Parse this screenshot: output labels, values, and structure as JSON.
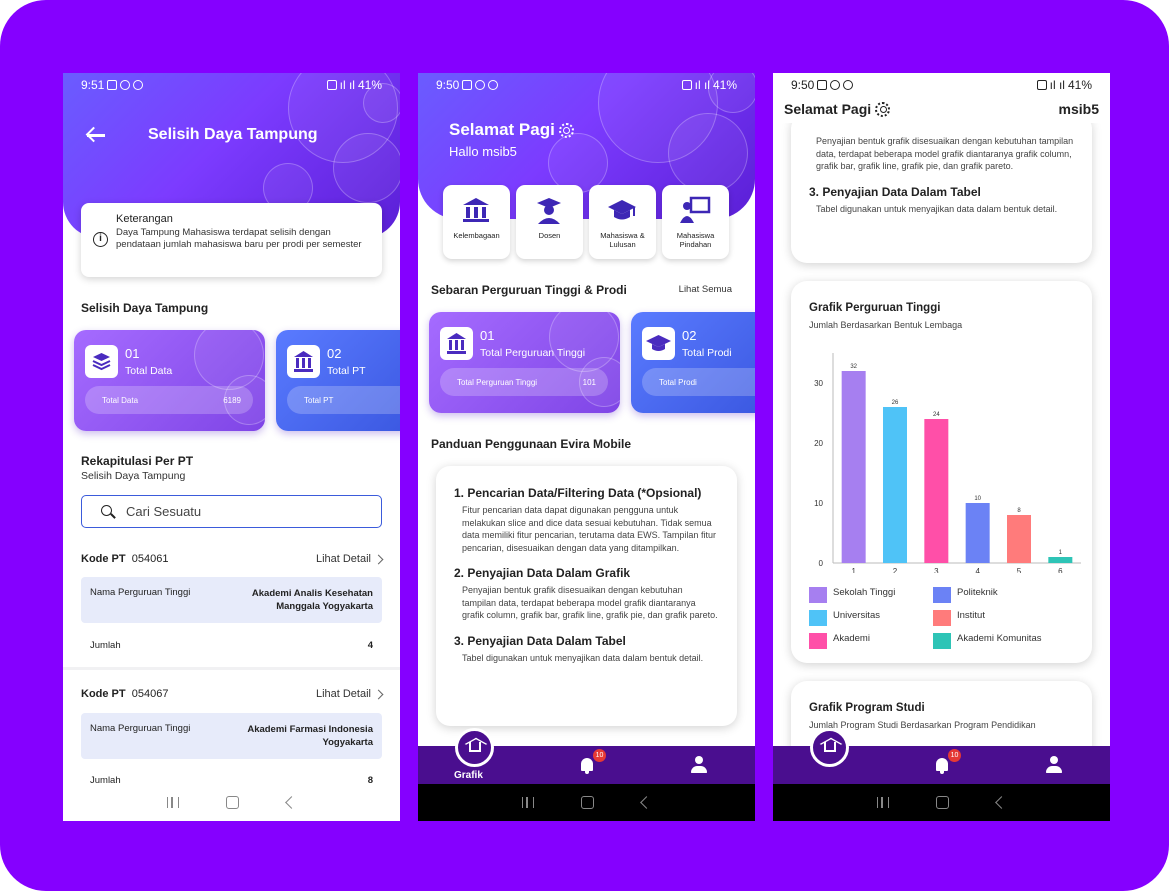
{
  "status_bars": {
    "p1_time": "9:51",
    "p2_time": "9:50",
    "p3_time": "9:50",
    "battery": "41%"
  },
  "screen1": {
    "title": "Selisih Daya Tampung",
    "keterangan_title": "Keterangan",
    "keterangan_body": "Daya Tampung Mahasiswa terdapat selisih dengan pendataan jumlah mahasiswa baru per prodi per semester",
    "section_title": "Selisih Daya Tampung",
    "cards": [
      {
        "num": "01",
        "label": "Total Data",
        "pill_label": "Total Data",
        "pill_value": "6189"
      },
      {
        "num": "02",
        "label": "Total PT",
        "pill_label": "Total PT",
        "pill_value": ""
      }
    ],
    "rekap_title": "Rekapitulasi Per PT",
    "rekap_sub": "Selisih Daya Tampung",
    "search_placeholder": "Cari Sesuatu",
    "rows": [
      {
        "kode_label": "Kode PT",
        "kode": "054061",
        "detail": "Lihat Detail",
        "nama_label": "Nama Perguruan Tinggi",
        "nama": "Akademi Analis Kesehatan Manggala Yogyakarta",
        "jumlah_label": "Jumlah",
        "jumlah": "4"
      },
      {
        "kode_label": "Kode PT",
        "kode": "054067",
        "detail": "Lihat Detail",
        "nama_label": "Nama Perguruan Tinggi",
        "nama": "Akademi Farmasi Indonesia Yogyakarta",
        "jumlah_label": "Jumlah",
        "jumlah": "8"
      }
    ]
  },
  "screen2": {
    "greeting": "Selamat Pagi",
    "hello": "Hallo msib5",
    "menu": [
      "Kelembagaan",
      "Dosen",
      "Mahasiswa & Lulusan",
      "Mahasiswa Pindahan"
    ],
    "sebaran_title": "Sebaran Perguruan Tinggi & Prodi",
    "lihat_semua": "Lihat Semua",
    "cards": [
      {
        "num": "01",
        "label": "Total Perguruan Tinggi",
        "pill_label": "Total Perguruan Tinggi",
        "pill_value": "101"
      },
      {
        "num": "02",
        "label": "Total Prodi",
        "pill_label": "Total Prodi",
        "pill_value": ""
      }
    ],
    "panduan_title": "Panduan Penggunaan Evira Mobile",
    "panduan": [
      {
        "h": "1. Pencarian Data/Filtering Data (*Opsional)",
        "b": "Fitur pencarian data dapat digunakan pengguna untuk melakukan slice and dice data sesuai kebutuhan. Tidak semua data memiliki fitur pencarian, terutama data EWS. Tampilan fitur pencarian, disesuaikan dengan data yang ditampilkan."
      },
      {
        "h": "2. Penyajian Data Dalam Grafik",
        "b": "Penyajian bentuk grafik disesuaikan dengan kebutuhan tampilan data, terdapat beberapa model grafik diantaranya grafik column, grafik bar, grafik line, grafik pie, dan grafik pareto."
      },
      {
        "h": "3. Penyajian Data Dalam Tabel",
        "b": "Tabel digunakan untuk menyajikan data dalam bentuk detail."
      }
    ],
    "nav_label": "Grafik",
    "badge": "10"
  },
  "screen3": {
    "greeting": "Selamat Pagi",
    "user": "msib5",
    "top_card_body": "Penyajian bentuk grafik disesuaikan dengan kebutuhan tampilan data, terdapat beberapa model grafik diantaranya grafik column, grafik bar, grafik line, grafik pie, dan grafik pareto.",
    "top_card_h": "3. Penyajian Data Dalam Tabel",
    "top_card_b": "Tabel digunakan untuk menyajikan data dalam bentuk detail.",
    "chart_card_title": "Grafik Perguruan Tinggi",
    "chart_card_sub": "Jumlah Berdasarkan Bentuk Lembaga",
    "next_title": "Grafik Program Studi",
    "next_sub": "Jumlah Program Studi Berdasarkan Program Pendidikan",
    "badge": "10"
  },
  "chart_data": {
    "type": "bar",
    "categories": [
      "1",
      "2",
      "3",
      "4",
      "5",
      "6"
    ],
    "values": [
      32,
      26,
      24,
      10,
      8,
      1
    ],
    "colors": [
      "#a67ff0",
      "#4fc3f7",
      "#ff4fa8",
      "#6b82f5",
      "#ff7b7b",
      "#2ec4b6"
    ],
    "legend": [
      "Sekolah Tinggi",
      "Politeknik",
      "Universitas",
      "Institut",
      "Akademi",
      "Akademi Komunitas"
    ],
    "legend_colors": [
      "#a67ff0",
      "#6b82f5",
      "#4fc3f7",
      "#ff7b7b",
      "#ff4fa8",
      "#2ec4b6"
    ],
    "yticks": [
      0,
      10,
      20,
      30
    ],
    "ylim": [
      0,
      35
    ],
    "title": "Grafik Perguruan Tinggi",
    "subtitle": "Jumlah Berdasarkan Bentuk Lembaga"
  }
}
